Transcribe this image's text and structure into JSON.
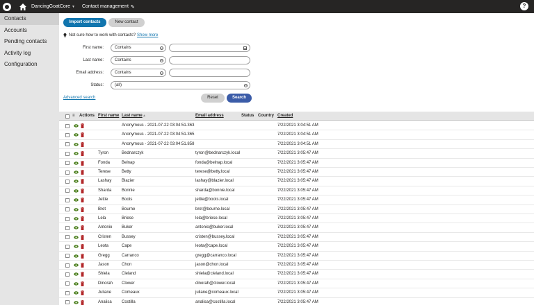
{
  "topbar": {
    "site_name": "DancingGoatCore",
    "app_name": "Contact management",
    "help_label": "?"
  },
  "sidebar": {
    "items": [
      {
        "label": "Contacts",
        "active": true
      },
      {
        "label": "Accounts"
      },
      {
        "label": "Pending contacts"
      },
      {
        "label": "Activity log"
      },
      {
        "label": "Configuration"
      }
    ]
  },
  "actions": {
    "import_label": "Import contacts",
    "new_label": "New contact"
  },
  "info": {
    "text": "Not sure how to work with contacts?",
    "link": "Show more"
  },
  "filter": {
    "first_name_label": "First name:",
    "last_name_label": "Last name:",
    "email_label": "Email address:",
    "status_label": "Status:",
    "operator": "Contains",
    "status_value": "(all)",
    "advanced_label": "Advanced search",
    "reset_label": "Reset",
    "search_label": "Search"
  },
  "table": {
    "headers": {
      "actions": "Actions",
      "first_name": "First name",
      "last_name": "Last name",
      "email": "Email address",
      "status": "Status",
      "country": "Country",
      "created": "Created"
    },
    "rows": [
      {
        "first": "",
        "last": "Anonymous - 2021-07-22 03:04:51.363",
        "email": "",
        "created": "7/22/2021 3:04:51 AM"
      },
      {
        "first": "",
        "last": "Anonymous - 2021-07-22 03:04:51.365",
        "email": "",
        "created": "7/22/2021 3:04:51 AM"
      },
      {
        "first": "",
        "last": "Anonymous - 2021-07-22 03:04:51.858",
        "email": "",
        "created": "7/22/2021 3:04:51 AM"
      },
      {
        "first": "Tyron",
        "last": "Bednarczyk",
        "email": "tyron@bednarczyk.local",
        "created": "7/22/2021 3:05:47 AM"
      },
      {
        "first": "Fonda",
        "last": "Belnap",
        "email": "fonda@belnap.local",
        "created": "7/22/2021 3:05:47 AM"
      },
      {
        "first": "Terese",
        "last": "Betty",
        "email": "terese@betty.local",
        "created": "7/22/2021 3:05:47 AM"
      },
      {
        "first": "Lashay",
        "last": "Blazier",
        "email": "lashay@blazier.local",
        "created": "7/22/2021 3:05:47 AM"
      },
      {
        "first": "Sharda",
        "last": "Bonnie",
        "email": "sharda@bonnie.local",
        "created": "7/22/2021 3:05:47 AM"
      },
      {
        "first": "Jettie",
        "last": "Boots",
        "email": "jettie@boots.local",
        "created": "7/22/2021 3:05:47 AM"
      },
      {
        "first": "Bret",
        "last": "Bourne",
        "email": "bret@bourne.local",
        "created": "7/22/2021 3:05:47 AM"
      },
      {
        "first": "Lela",
        "last": "Briese",
        "email": "lela@briese.local",
        "created": "7/22/2021 3:05:47 AM"
      },
      {
        "first": "Antonio",
        "last": "Buker",
        "email": "antonio@buker.local",
        "created": "7/22/2021 3:05:47 AM"
      },
      {
        "first": "Cristen",
        "last": "Bussey",
        "email": "cristen@bussey.local",
        "created": "7/22/2021 3:05:47 AM"
      },
      {
        "first": "Leota",
        "last": "Cape",
        "email": "leota@cape.local",
        "created": "7/22/2021 3:05:47 AM"
      },
      {
        "first": "Gregg",
        "last": "Carranco",
        "email": "gregg@carranco.local",
        "created": "7/22/2021 3:05:47 AM"
      },
      {
        "first": "Jason",
        "last": "Chon",
        "email": "jason@chon.local",
        "created": "7/22/2021 3:05:47 AM"
      },
      {
        "first": "Shiela",
        "last": "Cleland",
        "email": "shiela@cleland.local",
        "created": "7/22/2021 3:05:47 AM"
      },
      {
        "first": "Dinorah",
        "last": "Clower",
        "email": "dinorah@clower.local",
        "created": "7/22/2021 3:05:47 AM"
      },
      {
        "first": "Juliane",
        "last": "Comeaux",
        "email": "juliane@comeaux.local",
        "created": "7/22/2021 3:05:47 AM"
      },
      {
        "first": "Analisa",
        "last": "Costilla",
        "email": "analisa@costilla.local",
        "created": "7/22/2021 3:05:47 AM"
      }
    ]
  },
  "colors": {
    "topbar": "#262524",
    "primary": "#1175ae",
    "search": "#3b5ca8",
    "view_icon": "#497d1a",
    "delete_icon": "#b12628"
  }
}
